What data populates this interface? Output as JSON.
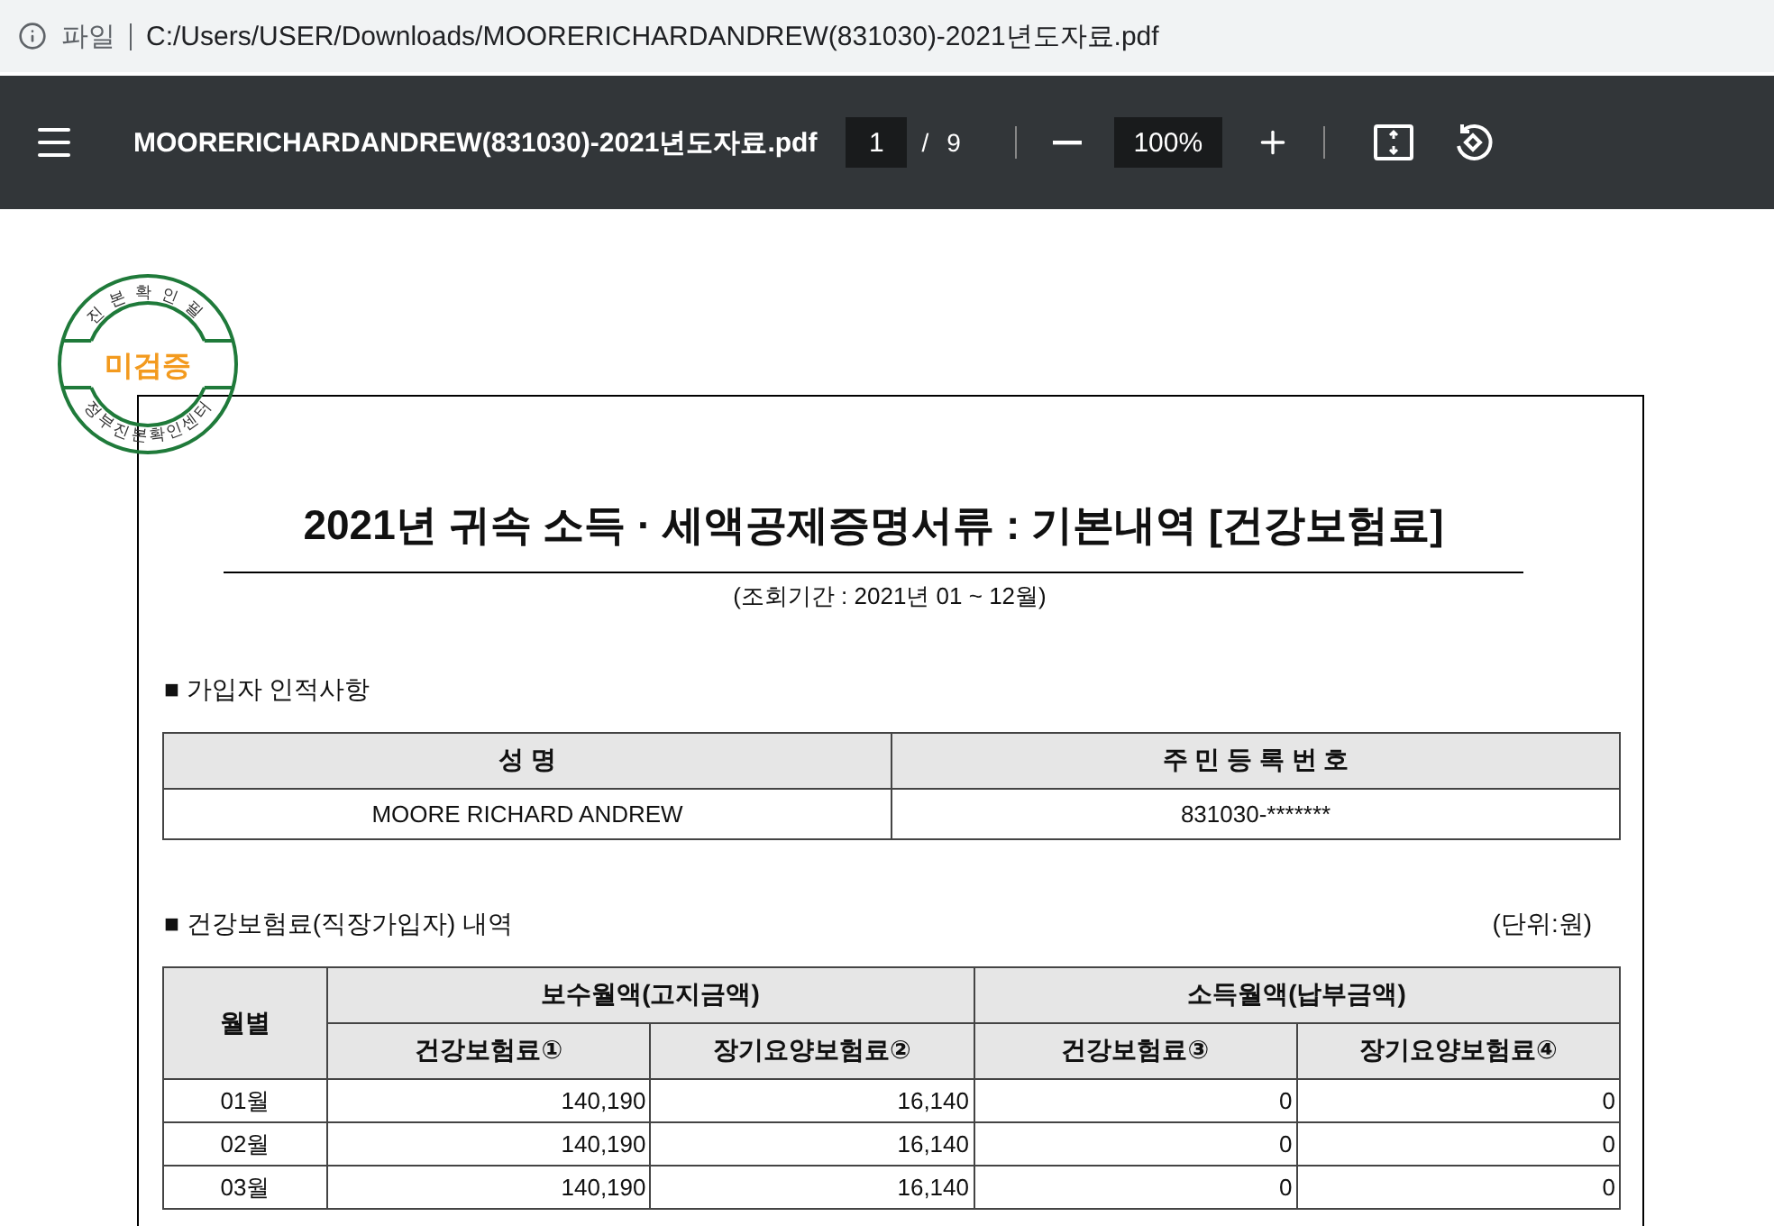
{
  "address_bar": {
    "scheme_label": "파일",
    "url": "C:/Users/USER/Downloads/MOORERICHARDANDREW(831030)-2021년도자료.pdf"
  },
  "toolbar": {
    "title": "MOORERICHARDANDREW(831030)-2021년도자료.pdf",
    "page": "1",
    "page_separator": "/",
    "page_total": "9",
    "zoom": "100%"
  },
  "stamp": {
    "top_text": "진본확인필",
    "status": "미검증",
    "bottom_text": "정부진본확인센터"
  },
  "document": {
    "title": "2021년 귀속 소득 · 세액공제증명서류 : 기본내역 [건강보험료]",
    "period": "(조회기간 : 2021년 01 ~ 12월)",
    "subscriber_section": {
      "heading": "■ 가입자 인적사항",
      "columns": [
        "성 명",
        "주 민 등 록 번 호"
      ],
      "row": [
        "MOORE RICHARD ANDREW",
        "831030-*******"
      ]
    },
    "premium_section": {
      "heading": "■ 건강보험료(직장가입자) 내역",
      "unit": "(단위:원)",
      "month_header": "월별",
      "groups": [
        {
          "label": "보수월액(고지금액)",
          "columns": [
            "건강보험료①",
            "장기요양보험료②"
          ]
        },
        {
          "label": "소득월액(납부금액)",
          "columns": [
            "건강보험료③",
            "장기요양보험료④"
          ]
        }
      ],
      "rows": [
        [
          "01월",
          "140,190",
          "16,140",
          "0",
          "0"
        ],
        [
          "02월",
          "140,190",
          "16,140",
          "0",
          "0"
        ],
        [
          "03월",
          "140,190",
          "16,140",
          "0",
          "0"
        ]
      ]
    }
  }
}
